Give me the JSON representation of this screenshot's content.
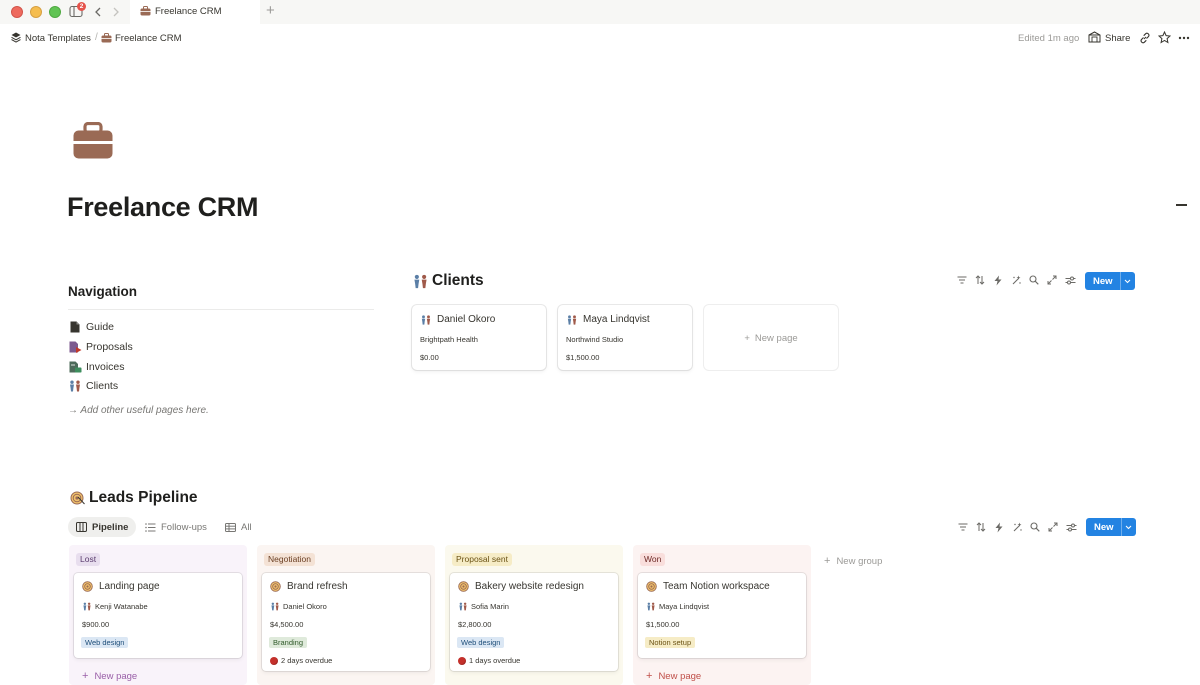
{
  "window": {
    "tab_title": "Freelance CRM",
    "badge_count": "2"
  },
  "breadcrumb": {
    "workspace": "Nota Templates",
    "page": "Freelance CRM"
  },
  "topbar": {
    "edited": "Edited 1m ago",
    "share_label": "Share"
  },
  "page": {
    "title": "Freelance CRM",
    "icon": "briefcase-icon"
  },
  "navigation": {
    "heading": "Navigation",
    "items": [
      {
        "label": "Guide",
        "icon": "document-icon"
      },
      {
        "label": "Proposals",
        "icon": "proposal-icon"
      },
      {
        "label": "Invoices",
        "icon": "invoice-icon"
      },
      {
        "label": "Clients",
        "icon": "people-icon"
      }
    ],
    "hint": "→ Add other useful pages here."
  },
  "clients": {
    "title": "Clients",
    "new_label": "New",
    "new_page_label": "New page",
    "cards": [
      {
        "name": "Daniel Okoro",
        "company": "Brightpath Health",
        "amount": "$0.00"
      },
      {
        "name": "Maya Lindqvist",
        "company": "Northwind Studio",
        "amount": "$1,500.00"
      }
    ]
  },
  "leads": {
    "title": "Leads Pipeline",
    "views": [
      {
        "label": "Pipeline",
        "icon": "board-icon",
        "active": true
      },
      {
        "label": "Follow-ups",
        "icon": "list-icon",
        "active": false
      },
      {
        "label": "All",
        "icon": "table-icon",
        "active": false
      }
    ],
    "new_label": "New",
    "new_group_label": "New group",
    "new_page_label": "New page",
    "columns": [
      {
        "name": "Lost",
        "card": {
          "title": "Landing page",
          "client": "Kenji Watanabe",
          "amount": "$900.00",
          "tag": "Web design",
          "overdue": ""
        }
      },
      {
        "name": "Negotiation",
        "card": {
          "title": "Brand refresh",
          "client": "Daniel Okoro",
          "amount": "$4,500.00",
          "tag": "Branding",
          "overdue": "2 days overdue"
        }
      },
      {
        "name": "Proposal sent",
        "card": {
          "title": "Bakery website redesign",
          "client": "Sofia Marin",
          "amount": "$2,800.00",
          "tag": "Web design",
          "overdue": "1 days overdue"
        }
      },
      {
        "name": "Won",
        "card": {
          "title": "Team Notion workspace",
          "client": "Maya Lindqvist",
          "amount": "$1,500.00",
          "tag": "Notion setup",
          "overdue": ""
        }
      }
    ]
  },
  "colors": {
    "accent": "#2383e2",
    "briefcase": "#9a6a55",
    "lost_bg": "#f9f3fa",
    "lost_tag": "#e8deee",
    "negotiation_bg": "#fbf5f2",
    "negotiation_tag": "#f4e2d5",
    "proposal_bg": "#fbf9ee",
    "proposal_tag": "#f6ecc6",
    "won_bg": "#fcf3f2",
    "won_tag": "#f9dedc"
  }
}
